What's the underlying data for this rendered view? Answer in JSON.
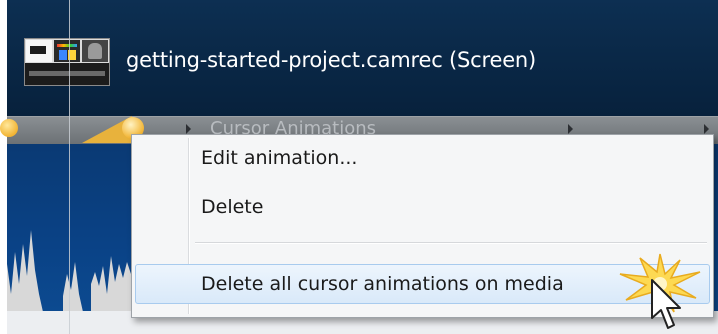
{
  "timeline": {
    "media_title": "getting-started-project.camrec (Screen)",
    "animation_track_label": "Cursor Animations",
    "colors": {
      "track_background": "#0b2a4a",
      "animation_accent": "#f2b433",
      "lower_track": "#0a4286",
      "waveform": "#d8d8d8"
    }
  },
  "context_menu": {
    "items": [
      {
        "label": "Edit animation...",
        "highlighted": false
      },
      {
        "label": "Delete",
        "highlighted": false
      },
      {
        "label": "Delete all cursor animations on media",
        "highlighted": true
      }
    ],
    "highlight_color": "#d9e9f9"
  },
  "icons": {
    "media_thumbnail": "media-thumbnail-icon",
    "click_highlight": "click-burst-icon",
    "pointer": "mouse-pointer-icon"
  }
}
